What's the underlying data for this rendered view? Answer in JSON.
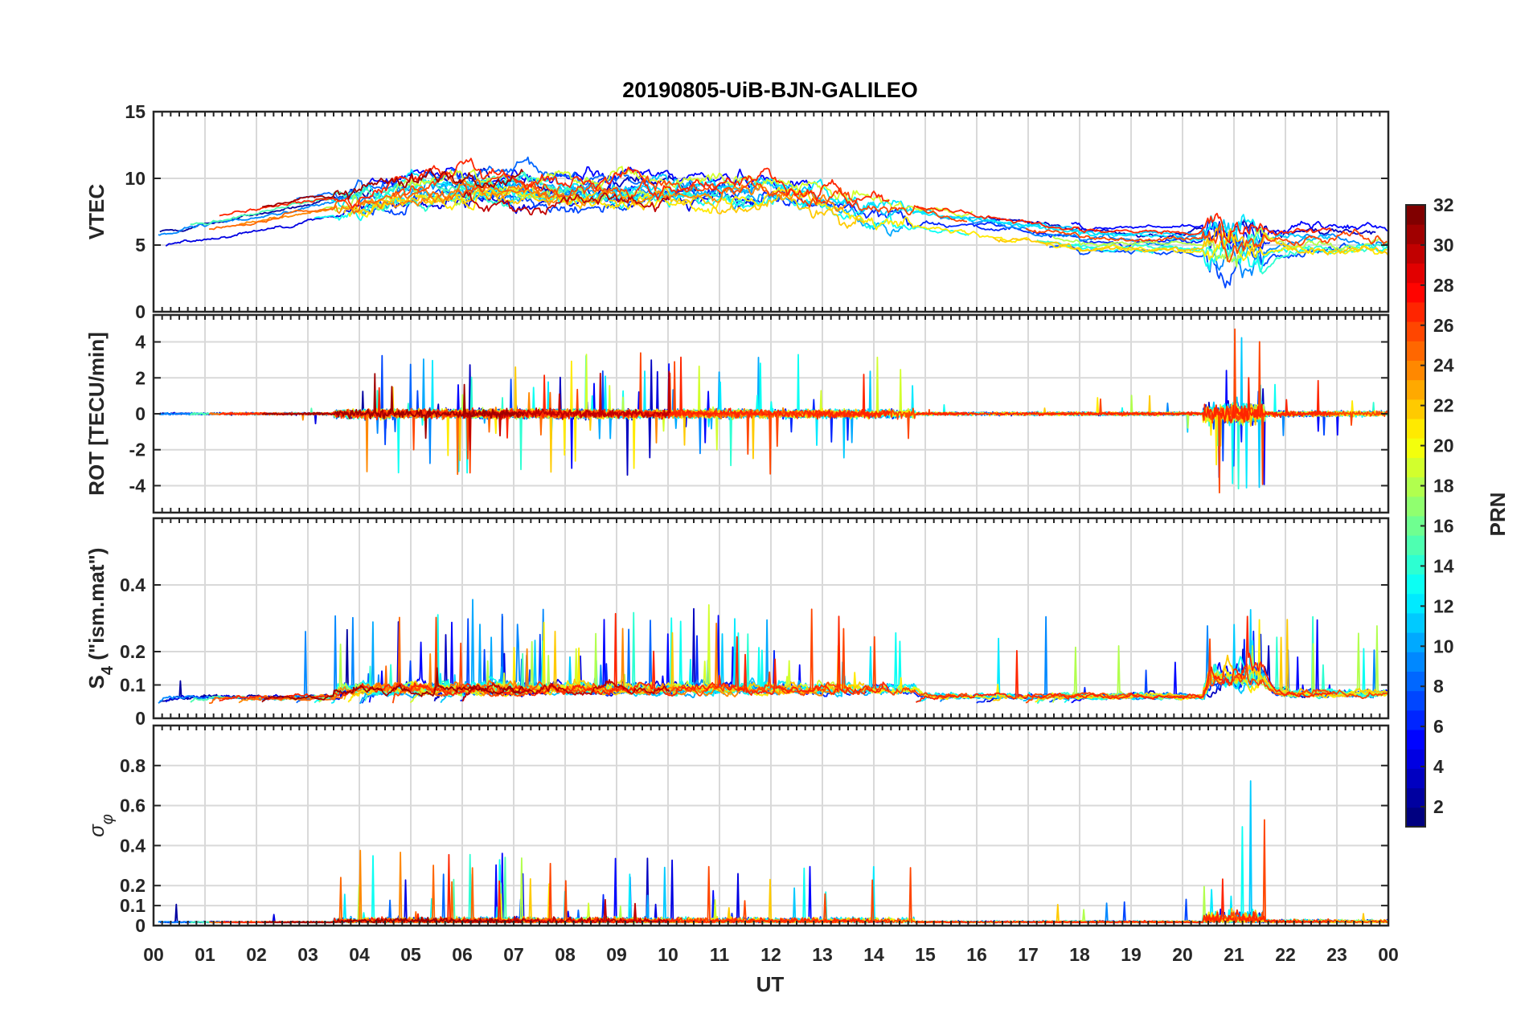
{
  "chart_data": {
    "type": "line",
    "title": "20190805-UiB-BJN-GALILEO",
    "xlabel": "UT",
    "xlim": [
      0,
      24
    ],
    "x_tick_labels": [
      "00",
      "01",
      "02",
      "03",
      "04",
      "05",
      "06",
      "07",
      "08",
      "09",
      "10",
      "11",
      "12",
      "13",
      "14",
      "15",
      "16",
      "17",
      "18",
      "19",
      "20",
      "21",
      "22",
      "23",
      "00"
    ],
    "panels": [
      {
        "ylabel": "VTEC",
        "ylim": [
          0,
          15
        ],
        "yticks": [
          0,
          5,
          10,
          15
        ],
        "ytick_labels": [
          "0",
          "5",
          "10",
          "15"
        ]
      },
      {
        "ylabel": "ROT [TECU/min]",
        "ylim": [
          -5.5,
          5.5
        ],
        "yticks": [
          -4,
          -2,
          0,
          2,
          4
        ],
        "ytick_labels": [
          "-4",
          "-2",
          "0",
          "2",
          "4"
        ]
      },
      {
        "ylabel": "S4 (\"ism.mat\")",
        "ylabel_main": "S",
        "ylabel_sub": "4",
        "ylabel_rest": " (\"ism.mat\")",
        "ylim": [
          0,
          0.6
        ],
        "yticks": [
          0,
          0.1,
          0.2,
          0.4
        ],
        "ytick_labels": [
          "0",
          "0.1",
          "0.2",
          "0.4"
        ]
      },
      {
        "ylabel": "σφ",
        "ylabel_main": "σ",
        "ylabel_sub": "φ",
        "ylim": [
          0,
          1
        ],
        "yticks": [
          0,
          0.1,
          0.2,
          0.4,
          0.6,
          0.8
        ],
        "ytick_labels": [
          "0",
          "0.1",
          "0.2",
          "0.4",
          "0.6",
          "0.8"
        ]
      }
    ],
    "colorbar": {
      "label": "PRN",
      "range": [
        1,
        32
      ],
      "ticks": [
        2,
        4,
        6,
        8,
        10,
        12,
        14,
        16,
        18,
        20,
        22,
        24,
        26,
        28,
        30,
        32
      ],
      "tick_labels": [
        "2",
        "4",
        "6",
        "8",
        "10",
        "12",
        "14",
        "16",
        "18",
        "20",
        "22",
        "24",
        "26",
        "28",
        "30",
        "32"
      ],
      "colormap": "jet"
    },
    "grid": true,
    "series_prn": [
      2,
      3,
      4,
      5,
      6,
      7,
      8,
      9,
      10,
      11,
      12,
      13,
      14,
      15,
      18,
      19,
      21,
      22,
      24,
      25,
      26,
      27,
      30,
      31
    ]
  }
}
